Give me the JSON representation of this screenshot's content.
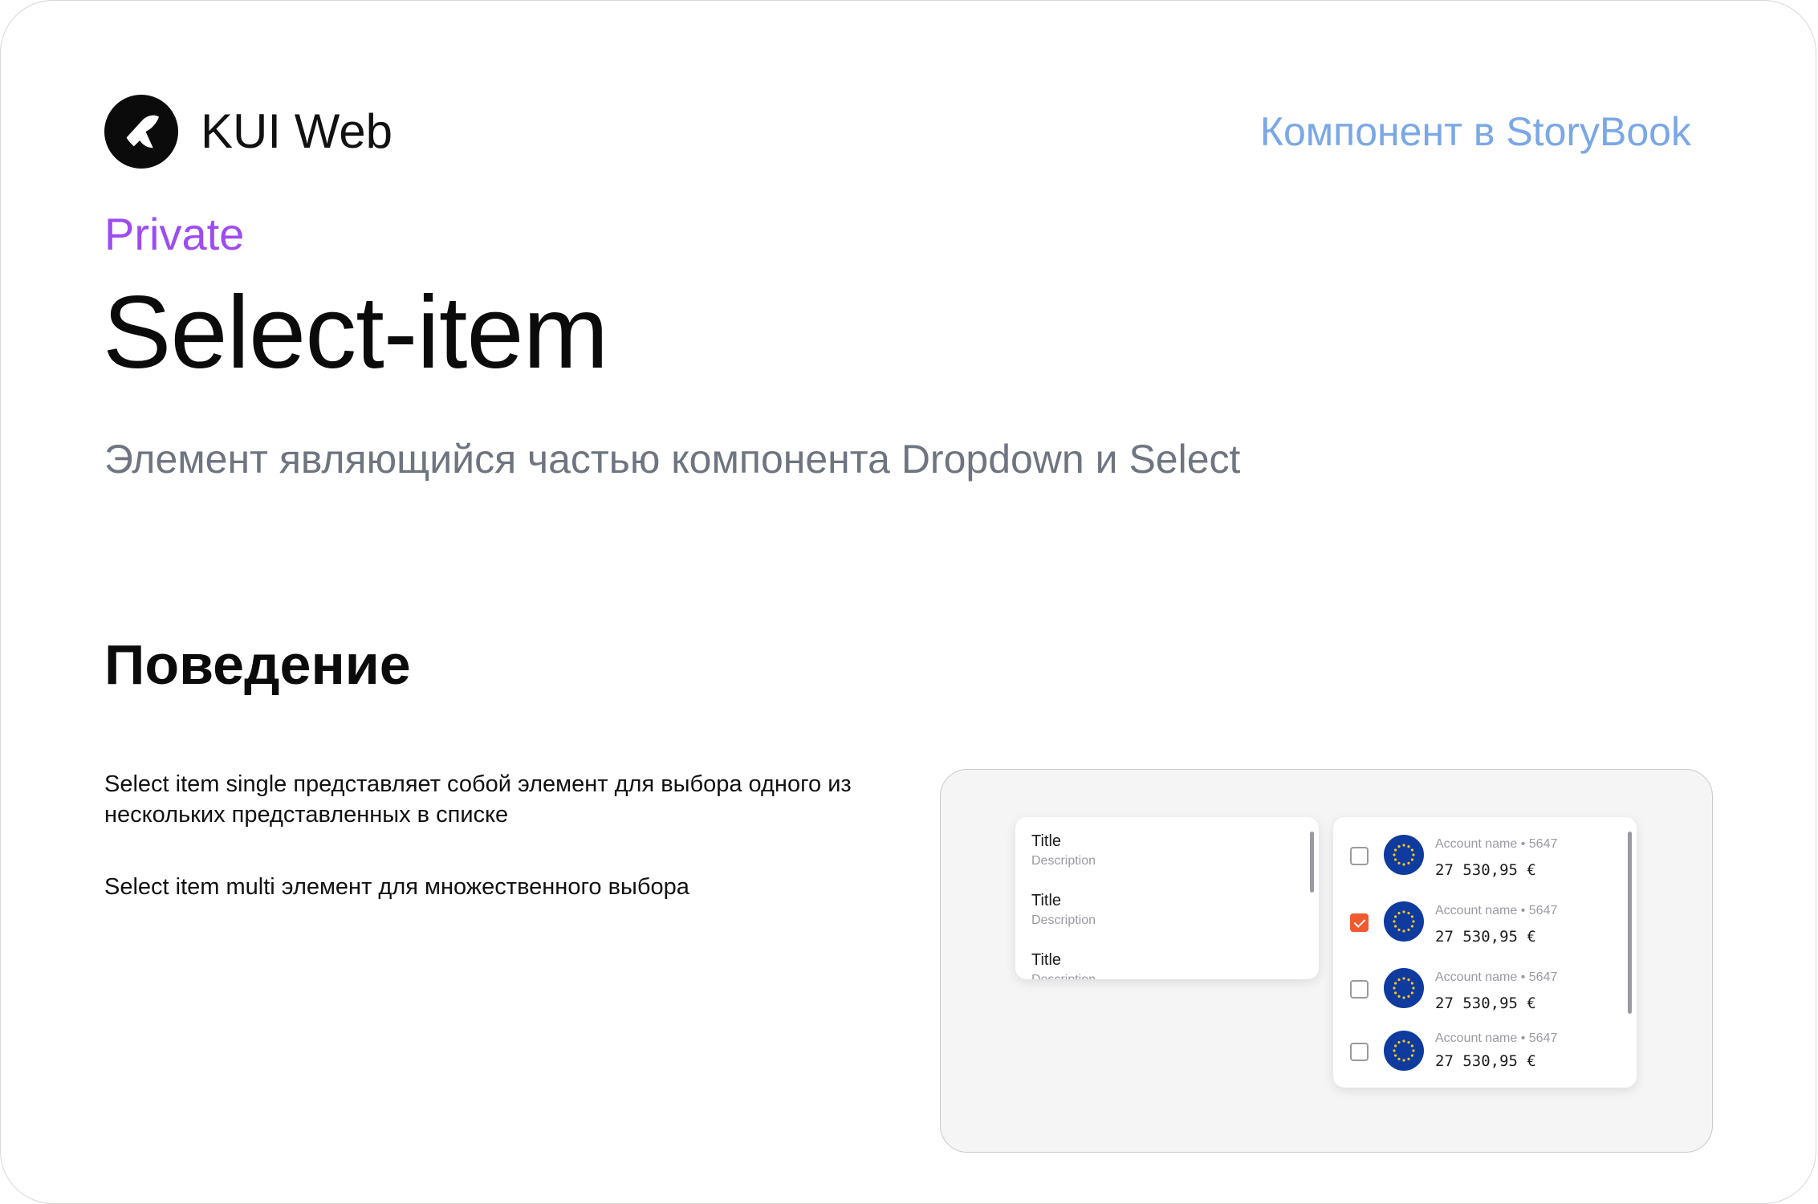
{
  "header": {
    "logo_text": "KUI Web",
    "storybook_link": "Компонент в StoryBook"
  },
  "page": {
    "badge": "Private",
    "title": "Select-item",
    "subtitle": "Элемент являющийся частью компонента Dropdown и Select"
  },
  "section": {
    "title": "Поведение",
    "descriptions": [
      "Select item single представляет собой элемент для выбора одного из нескольких представленных в списке",
      "Select item multi элемент для множественного выбора"
    ]
  },
  "single_select": {
    "items": [
      {
        "title": "Title",
        "description": "Description"
      },
      {
        "title": "Title",
        "description": "Description"
      },
      {
        "title": "Title",
        "description": "Description"
      }
    ]
  },
  "multi_select": {
    "items": [
      {
        "name": "Account name • 5647",
        "amount": "27 530,95 €",
        "checked": false
      },
      {
        "name": "Account name • 5647",
        "amount": "27 530,95 €",
        "checked": true
      },
      {
        "name": "Account name • 5647",
        "amount": "27 530,95 €",
        "checked": false
      },
      {
        "name": "Account name • 5647",
        "amount": "27 530,95 €",
        "checked": false
      }
    ]
  },
  "colors": {
    "link": "#7aa7e6",
    "badge": "#9d4cf0",
    "checkbox_checked": "#ef5a2e",
    "flag_blue": "#0f3a9e",
    "flag_stars": "#f3c623"
  },
  "icons": {
    "logo": "kui-logo-icon",
    "flag": "eu-flag-icon",
    "checkbox": "checkbox-icon"
  }
}
